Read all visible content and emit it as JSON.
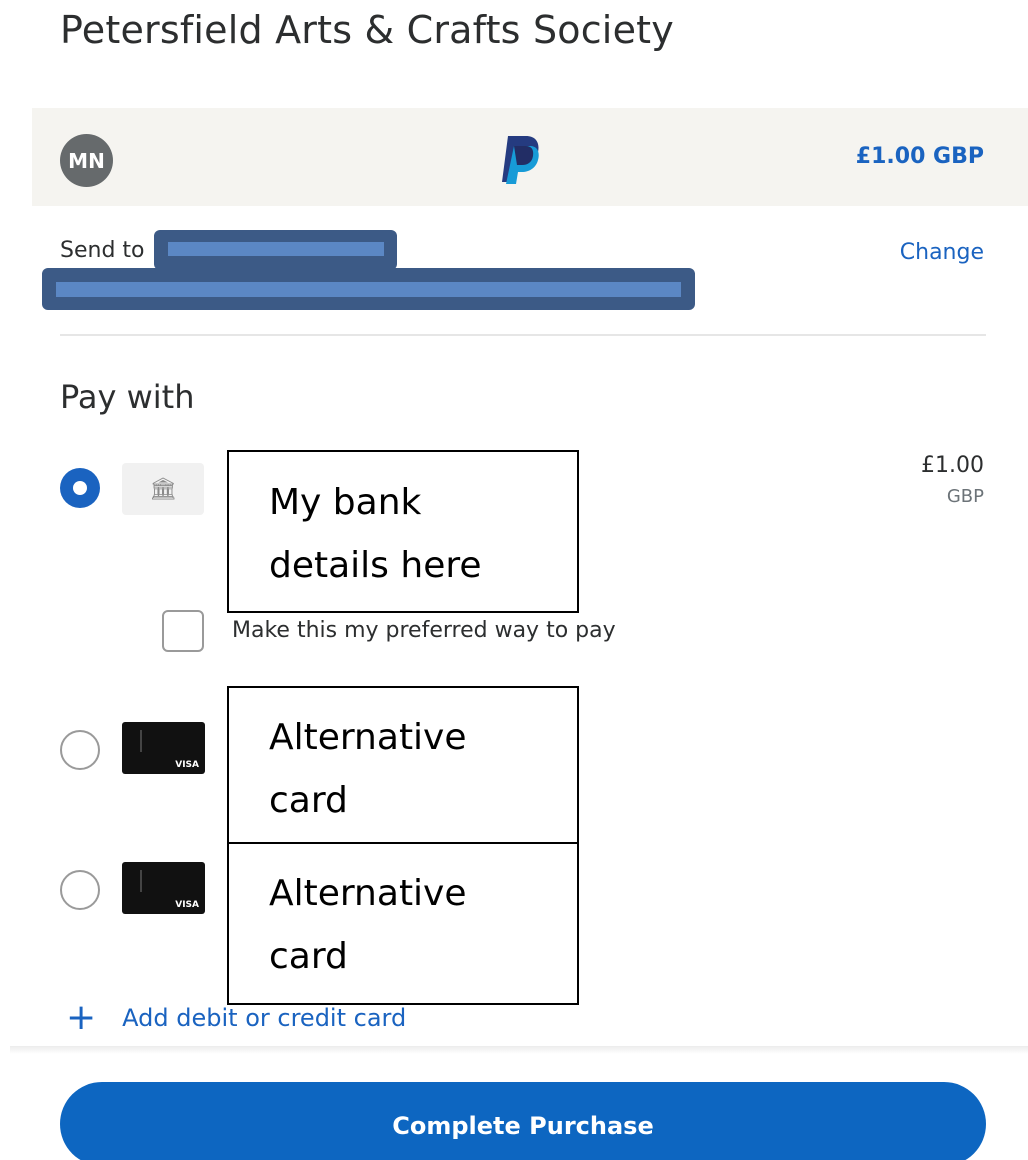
{
  "merchant": {
    "title": "Petersfield Arts & Crafts Society"
  },
  "summary": {
    "avatar_initials": "MN",
    "logo_icon": "paypal-logo-icon",
    "total": "£1.00 GBP"
  },
  "shipping": {
    "send_to_label": "Send to",
    "change_label": "Change"
  },
  "payment": {
    "heading": "Pay with",
    "options": [
      {
        "type": "bank",
        "icon": "bank-icon",
        "selected": true,
        "label_line1": "My bank",
        "label_line2": "details here",
        "amount": "£1.00",
        "currency": "GBP"
      },
      {
        "type": "card",
        "icon": "visa-card-icon",
        "brand": "VISA",
        "selected": false,
        "label_line1": "Alternative",
        "label_line2": "card"
      },
      {
        "type": "card",
        "icon": "visa-card-icon",
        "brand": "VISA",
        "selected": false,
        "label_line1": "Alternative",
        "label_line2": "card"
      }
    ],
    "preferred_checkbox_label": "Make this my preferred way to pay",
    "add_card_plus": "+",
    "add_card_label": "Add debit or credit card"
  },
  "footer": {
    "complete_label": "Complete Purchase"
  },
  "colors": {
    "accent": "#0d66c1",
    "link": "#1a63c0",
    "bar_bg": "#f5f4f0",
    "avatar_bg": "#666a6c"
  }
}
